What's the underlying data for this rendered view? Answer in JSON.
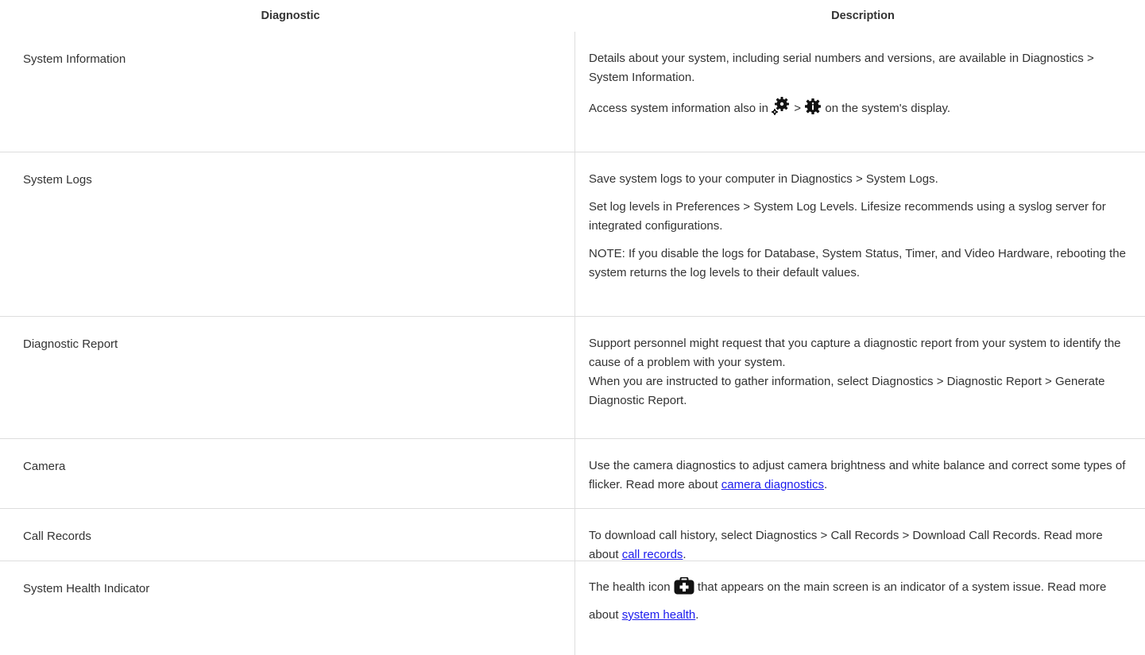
{
  "header": {
    "diagnostic": "Diagnostic",
    "description": "Description"
  },
  "rows": [
    {
      "name": "System Information",
      "p1": "Details about your system, including serial numbers and versions, are available in Diagnostics > System Information.",
      "p2_before": "Access system information also in ",
      "p2_sep": " > ",
      "p2_after": " on the system's display."
    },
    {
      "name": "System Logs",
      "p1": "Save system logs to your computer in Diagnostics > System Logs.",
      "p2": "Set log levels in Preferences > System Log Levels. Lifesize recommends using a syslog server for integrated configurations.",
      "p3": "NOTE: If you disable the logs for Database, System Status, Timer, and Video Hardware, rebooting the system returns the log levels to their default values."
    },
    {
      "name": "Diagnostic Report",
      "p1": "Support personnel might request that you capture a diagnostic report from your system to identify the cause of a problem with your system.",
      "p2": "When you are instructed to gather information, select Diagnostics > Diagnostic Report > Generate Diagnostic Report."
    },
    {
      "name": "Camera",
      "text": "Use the camera diagnostics to adjust camera brightness and white balance and correct some types of flicker. Read more about ",
      "link": "camera diagnostics",
      "end": "."
    },
    {
      "name": "Call Records",
      "text": "To download call history, select Diagnostics > Call Records > Download Call Records. Read more about ",
      "link": "call records",
      "end": "."
    },
    {
      "name": "System Health Indicator",
      "text_before": "The health icon ",
      "text_after": " that appears on the main screen is an indicator of a system issue. Read more about ",
      "link": "system health",
      "end": "."
    }
  ],
  "icons": {
    "settings": "gear-icon",
    "system_info": "info-gear-icon",
    "health": "health-kit-icon"
  },
  "colors": {
    "link": "#1a1aee",
    "text": "#333333",
    "divider": "#dddddd"
  }
}
